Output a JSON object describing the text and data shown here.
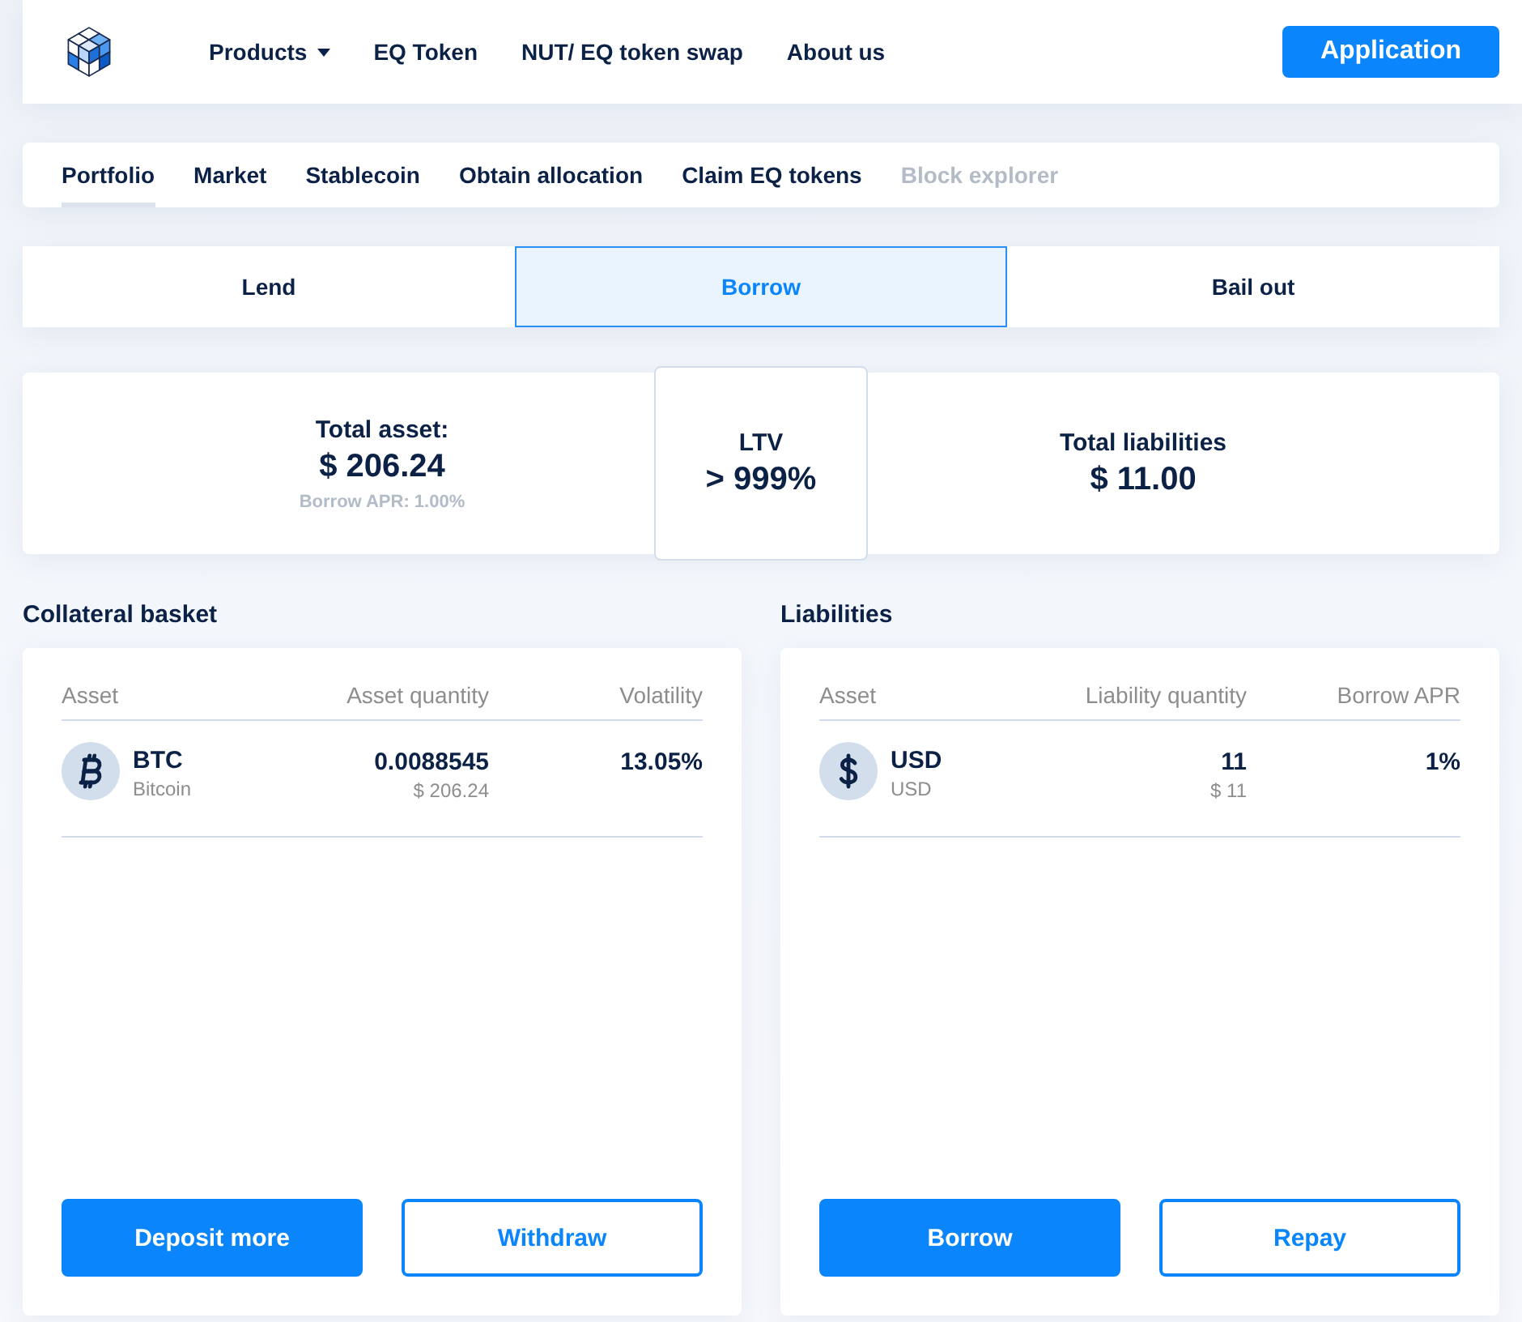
{
  "header": {
    "nav": [
      {
        "label": "Products",
        "dropdown": true
      },
      {
        "label": "EQ Token",
        "dropdown": false
      },
      {
        "label": "NUT/ EQ token swap",
        "dropdown": false
      },
      {
        "label": "About us",
        "dropdown": false
      }
    ],
    "action": "Application"
  },
  "tabs": [
    {
      "label": "Portfolio",
      "selected": true,
      "disabled": false
    },
    {
      "label": "Market",
      "selected": false,
      "disabled": false
    },
    {
      "label": "Stablecoin",
      "selected": false,
      "disabled": false
    },
    {
      "label": "Obtain allocation",
      "selected": false,
      "disabled": false
    },
    {
      "label": "Claim EQ tokens",
      "selected": false,
      "disabled": false
    },
    {
      "label": "Block explorer",
      "selected": false,
      "disabled": true
    }
  ],
  "modes": [
    {
      "label": "Lend",
      "selected": false
    },
    {
      "label": "Borrow",
      "selected": true
    },
    {
      "label": "Bail out",
      "selected": false
    }
  ],
  "summary": {
    "total_asset": {
      "label": "Total asset:",
      "value": "$ 206.24",
      "note": "Borrow APR: 1.00%"
    },
    "ltv": {
      "label": "LTV",
      "value": "> 999%"
    },
    "total_liabilities": {
      "label": "Total liabilities",
      "value": "$ 11.00"
    }
  },
  "panels": [
    {
      "title": "Collateral basket",
      "columns": [
        "Asset",
        "Asset quantity",
        "Volatility"
      ],
      "rows": [
        {
          "kind": "bitcoin",
          "symbol": "BTC",
          "name": "Bitcoin",
          "quantity": "0.0088545",
          "quantity_value": "$ 206.24",
          "rate": "13.05%"
        }
      ],
      "buttons": [
        {
          "label": "Deposit more",
          "kind": "primary"
        },
        {
          "label": "Withdraw",
          "kind": "outline"
        }
      ]
    },
    {
      "title": "Liabilities",
      "columns": [
        "Asset",
        "Liability quantity",
        "Borrow APR"
      ],
      "rows": [
        {
          "kind": "dollar",
          "symbol": "USD",
          "name": "USD",
          "quantity": "11",
          "quantity_value": "$ 11",
          "rate": "1%"
        }
      ],
      "buttons": [
        {
          "label": "Borrow",
          "kind": "primary"
        },
        {
          "label": "Repay",
          "kind": "outline"
        }
      ]
    }
  ]
}
